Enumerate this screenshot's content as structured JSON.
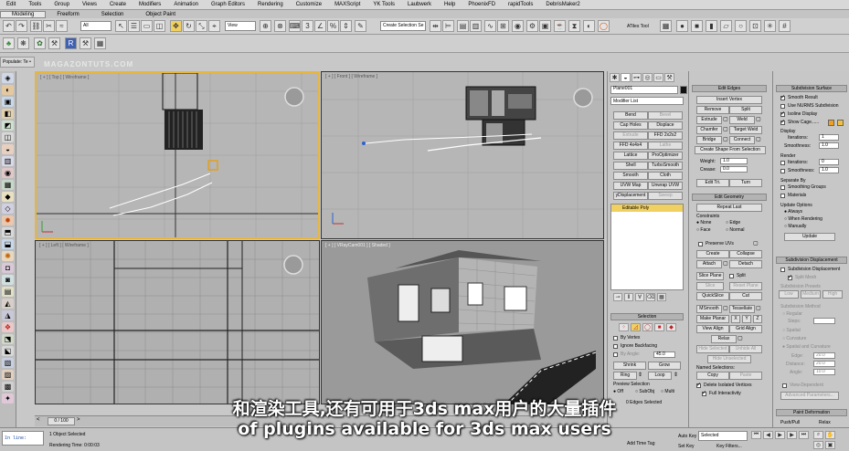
{
  "menu": [
    "Edit",
    "Tools",
    "Group",
    "Views",
    "Create",
    "Modifiers",
    "Animation",
    "Graph Editors",
    "Rendering",
    "Customize",
    "MAXScript",
    "YK Tools",
    "Laubwerk",
    "Help",
    "PhoenixFD",
    "rapidTools",
    "DebrisMaker2"
  ],
  "ribbon_tabs": [
    "Modeling",
    "Freeform",
    "Selection",
    "Object Paint"
  ],
  "toolbar": {
    "filter": "All",
    "refcoord": "View",
    "named_sel": "Create Selection Se",
    "atiles": "ATiles Tool"
  },
  "populate": "Populate: Te •",
  "watermark": "MAGAZONTUTS.COM",
  "viewports": {
    "top": "[ + ] [ Top ] [ Wireframe ]",
    "front": "[ + ] [ Front ] [ Wireframe ]",
    "left": "[ + ] [ Left ] [ Wireframe ]",
    "cam": "[ + ] [ VRayCam001 ] [ Shaded ]"
  },
  "command_panel": {
    "object_name": "Plane001",
    "modifier_list": "Modifier List",
    "modifiers": [
      "Bend",
      "Bevel",
      "Cap Holes",
      "Displace",
      "Extrude",
      "FFD 2x2x2",
      "FFD 4x4x4",
      "Lathe",
      "Lattice",
      "ProOptimizer",
      "Shell",
      "TurboSmooth",
      "Smooth",
      "Cloth",
      "UVW Map",
      "Unwrap UVW",
      "yDisplacement",
      "Sweep"
    ],
    "stack_item": "Editable Poly",
    "selection_title": "Selection",
    "by_vertex": "By Vertex",
    "ignore_backfacing": "Ignore Backfacing",
    "by_angle": "By Angle:",
    "by_angle_val": "45.0",
    "shrink": "Shrink",
    "grow": "Grow",
    "ring": "Ring",
    "loop": "Loop",
    "preview_selection": "Preview Selection",
    "off": "Off",
    "subobj": "SubObj",
    "multi": "Multi",
    "edges_selected": "0 Edges Selected"
  },
  "edit_edges": {
    "title": "Edit Edges",
    "insert_vertex": "Insert Vertex",
    "remove": "Remove",
    "split": "Split",
    "extrude": "Extrude",
    "weld": "Weld",
    "chamfer": "Chamfer",
    "target_weld": "Target Weld",
    "bridge": "Bridge",
    "connect": "Connect",
    "create_shape": "Create Shape From Selection",
    "weight": "Weight:",
    "weight_val": "1.0",
    "crease": "Crease:",
    "crease_val": "0.0",
    "edit_tri": "Edit Tri.",
    "turn": "Turn"
  },
  "edit_geometry": {
    "title": "Edit Geometry",
    "repeat_last": "Repeat Last",
    "constraints": "Constraints",
    "none": "None",
    "edge": "Edge",
    "face": "Face",
    "normal": "Normal",
    "preserve_uvs": "Preserve UVs",
    "create": "Create",
    "collapse": "Collapse",
    "attach": "Attach",
    "detach": "Detach",
    "slice_plane": "Slice Plane",
    "split": "Split",
    "slice": "Slice",
    "reset_plane": "Reset Plane",
    "quickslice": "QuickSlice",
    "cut": "Cut",
    "msmooth": "MSmooth",
    "tessellate": "Tessellate",
    "make_planar": "Make Planar",
    "x": "X",
    "y": "Y",
    "z": "Z",
    "view_align": "View Align",
    "grid_align": "Grid Align",
    "relax": "Relax",
    "hide_selected": "Hide Selected",
    "unhide_all": "Unhide All",
    "hide_unselected": "Hide Unselected",
    "named_selections": "Named Selections:",
    "copy": "Copy",
    "paste": "Paste",
    "delete_isolated": "Delete Isolated Vertices",
    "full_interactivity": "Full Interactivity"
  },
  "subdivision_surface": {
    "title": "Subdivision Surface",
    "smooth_result": "Smooth Result",
    "use_nurms": "Use NURMS Subdivision",
    "isoline": "Isoline Display",
    "show_cage": "Show Cage......",
    "display": "Display",
    "iterations": "Iterations:",
    "iter_val": "1",
    "smoothness": "Smoothness:",
    "smooth_val": "1.0",
    "render": "Render",
    "r_iter_val": "0",
    "r_smooth_val": "1.0",
    "separate_by": "Separate By",
    "smoothing_groups": "Smoothing Groups",
    "materials": "Materials",
    "update_options": "Update Options",
    "always": "Always",
    "when_rendering": "When Rendering",
    "manually": "Manually",
    "update": "Update"
  },
  "subdivision_displacement": {
    "title": "Subdivision Displacement",
    "subdiv_disp": "Subdivision Displacement",
    "split_mesh": "Split Mesh",
    "presets": "Subdivision Presets",
    "low": "Low",
    "medium": "Medium",
    "high": "High",
    "method": "Subdivision Method",
    "regular": "Regular",
    "steps": "Steps:",
    "spatial": "Spatial",
    "curvature": "Curvature",
    "spatial_curv": "Spatial and Curvature",
    "edge": "Edge:",
    "edge_val": "20.0",
    "distance": "Distance:",
    "dist_val": "20.0",
    "angle": "Angle:",
    "angle_val": "10.0",
    "view_dep": "View-Dependent",
    "advanced": "Advanced Parameters..."
  },
  "paint_deformation": {
    "title": "Paint Deformation",
    "push_pull": "Push/Pull",
    "relax": "Relax"
  },
  "timeline": {
    "frame": "0 / 100"
  },
  "status": {
    "objects": "1 Object Selected",
    "render_time": "Rendering Time: 0:00:03",
    "script": "In line:",
    "add_time_tag": "Add Time Tag",
    "auto_key": "Auto Key",
    "selected": "Selected",
    "set_key": "Set Key",
    "key_filters": "Key Filters..."
  },
  "subtitle": {
    "zh": "和渲染工具,还有可用于3ds max用户的大量插件",
    "en": "of plugins available for 3ds max users"
  }
}
